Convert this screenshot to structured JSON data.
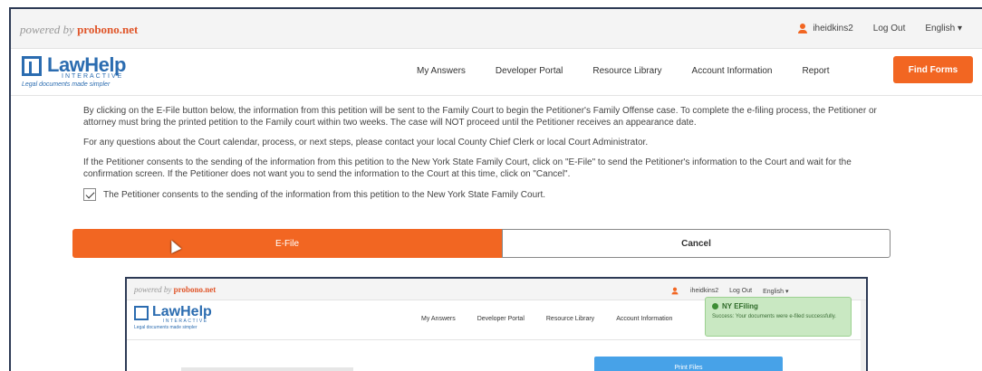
{
  "topbar": {
    "powered_prefix": "powered by",
    "powered_brand": "probono.net",
    "username": "iheidkins2",
    "logout": "Log Out",
    "language": "English ▾"
  },
  "logo": {
    "word": "LawHelp",
    "interactive": "INTERACTIVE",
    "tagline": "Legal documents made simpler"
  },
  "nav": {
    "items": [
      "My Answers",
      "Developer Portal",
      "Resource Library",
      "Account Information",
      "Report"
    ],
    "cta": "Find Forms"
  },
  "content": {
    "para1": "By clicking on the E-File button below, the information from this petition will be sent to the Family Court to begin the Petitioner's Family Offense case. To complete the e-filing process, the Petitioner or attorney must bring the printed petition to the Family court within two weeks. The case will NOT proceed until the Petitioner receives an appearance date.",
    "para2": "For any questions about the Court calendar, process, or next steps, please contact your local County Chief Clerk or local Court Administrator.",
    "para3": "If the Petitioner consents to the sending of the information from this petition to the New York State Family Court, click on \"E-File\" to send the Petitioner's information to the Court and wait for the confirmation screen. If the Petitioner does not want you to send the information to the Court at this time, click on \"Cancel\".",
    "consent": "The Petitioner consents to the sending of the information from this petition to the New York State Family Court.",
    "efile": "E-File",
    "cancel": "Cancel"
  },
  "inner": {
    "powered_prefix": "powered by",
    "powered_brand": "probono.net",
    "username": "iheidkins2",
    "logout": "Log Out",
    "language": "English ▾",
    "word": "LawHelp",
    "interactive": "INTERACTIVE",
    "tagline": "Legal documents made simpler",
    "nav": [
      "My Answers",
      "Developer Portal",
      "Resource Library",
      "Account Information"
    ],
    "toast_title": "NY EFiling",
    "toast_msg": "Success: Your documents were e-filed successfully.",
    "bar_label": "Print Files"
  },
  "colors": {
    "accent": "#f26622",
    "brand_blue": "#2b6cb0",
    "toast_green": "#c9e8c2",
    "inner_button": "#47a2e8"
  }
}
